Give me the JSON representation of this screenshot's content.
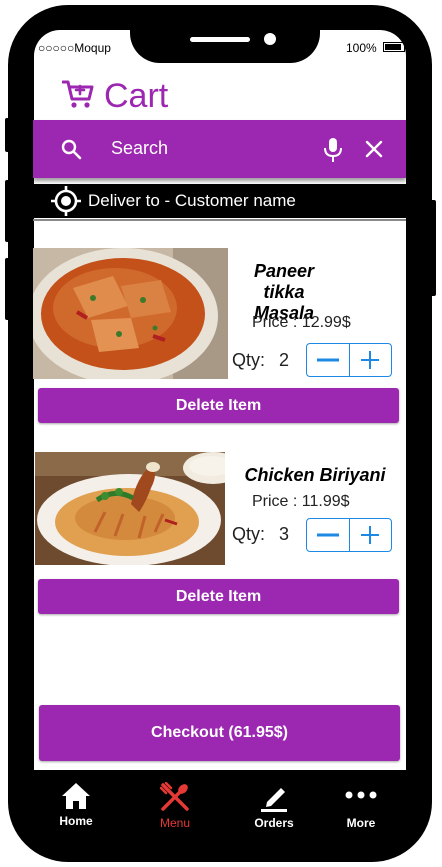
{
  "status": {
    "carrier": "○○○○○Moqup",
    "battery": "100%"
  },
  "header": {
    "title": "Cart"
  },
  "search": {
    "placeholder": "Search"
  },
  "deliver": {
    "label": "Deliver to - Customer name"
  },
  "items": [
    {
      "name": "Paneer tikka Masala",
      "price": "Price : 12.99$",
      "qty_label": "Qty:",
      "qty": "2",
      "delete_label": "Delete Item"
    },
    {
      "name": "Chicken Biriyani",
      "price": "Price : 11.99$",
      "qty_label": "Qty:",
      "qty": "3",
      "delete_label": "Delete Item"
    }
  ],
  "checkout": {
    "label": "Checkout (61.95$)"
  },
  "nav": [
    {
      "label": "Home",
      "icon": "home-icon",
      "color": "#ffffff"
    },
    {
      "label": "Menu",
      "icon": "fork-spoon-icon",
      "color": "#e53935"
    },
    {
      "label": "Orders",
      "icon": "pencil-icon",
      "color": "#ffffff"
    },
    {
      "label": "More",
      "icon": "more-dots-icon",
      "color": "#ffffff"
    }
  ],
  "colors": {
    "accent": "#9c27b0",
    "stepper": "#1e88e5",
    "menu_active": "#e53935"
  }
}
